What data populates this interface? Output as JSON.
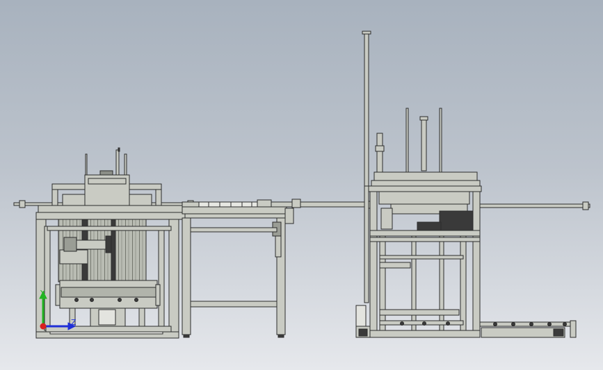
{
  "view": {
    "background_top": "#a8b2be",
    "background_bottom": "#e6e8ec",
    "frame_fill": "#c9cbc3",
    "frame_stroke": "#2c2c2c",
    "dark_part": "#3a3a3a"
  },
  "triad": {
    "y_label": "Y",
    "z_label": "Z",
    "y_color": "#22b422",
    "z_color": "#1f2fd8",
    "x_color": "#d82020"
  }
}
